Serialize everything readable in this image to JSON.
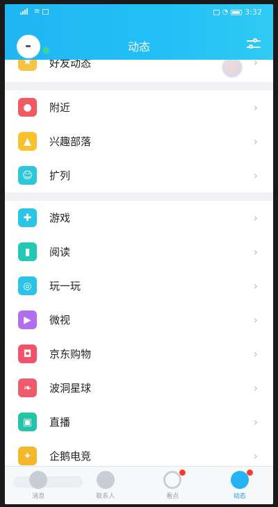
{
  "status_bar": {
    "time": "3:32"
  },
  "header": {
    "title": "动态"
  },
  "partial_item": {
    "label": "好友动态",
    "color": "#f6c343"
  },
  "groups": [
    [
      {
        "label": "附近",
        "icon": "location-pin-icon",
        "color": "#f25a63"
      },
      {
        "label": "兴趣部落",
        "icon": "triangle-tribe-icon",
        "color": "#f8c22c"
      },
      {
        "label": "扩列",
        "icon": "face-plus-icon",
        "color": "#2ec7d9"
      }
    ],
    [
      {
        "label": "游戏",
        "icon": "gamepad-icon",
        "color": "#2cc3e8"
      },
      {
        "label": "阅读",
        "icon": "book-icon",
        "color": "#24c9b3"
      },
      {
        "label": "玩一玩",
        "icon": "play-circle-icon",
        "color": "#2cc3e8"
      },
      {
        "label": "微视",
        "icon": "video-play-icon",
        "color": "#b16ff0"
      },
      {
        "label": "京东购物",
        "icon": "shopping-bag-icon",
        "color": "#f2536a"
      },
      {
        "label": "波洞星球",
        "icon": "planet-leaf-icon",
        "color": "#f05b6b"
      },
      {
        "label": "直播",
        "icon": "live-tv-icon",
        "color": "#23c5a8"
      },
      {
        "label": "企鹅电竞",
        "icon": "penguin-esports-icon",
        "color": "#f6b82b"
      }
    ]
  ],
  "tabbar": [
    {
      "label": "消息",
      "icon": "chat-icon",
      "active": false,
      "badge": false
    },
    {
      "label": "联系人",
      "icon": "contacts-icon",
      "active": false,
      "badge": false
    },
    {
      "label": "看点",
      "icon": "eye-icon",
      "active": false,
      "badge": true
    },
    {
      "label": "动态",
      "icon": "planet-icon",
      "active": true,
      "badge": true
    }
  ],
  "colors": {
    "header": "#22c0f6",
    "accent": "#1d9bf0",
    "badge": "#ff3b30"
  }
}
